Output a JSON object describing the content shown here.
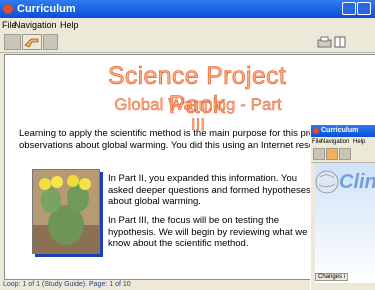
{
  "main_window": {
    "title": "Curriculum",
    "menu": [
      "File",
      "Navigation",
      "Help"
    ],
    "heading": "Science Project Pack",
    "subheading": "Global Warming - Part III",
    "intro": "Learning to apply the scientific method is the main purpose for this project. Part I, you made observations about global warming. You did this using an Internet resource called Artemis.",
    "para2": "In Part II, you expanded this information. You asked deeper questions and formed hypotheses about global warming.",
    "para3": "In Part III, the focus will be on testing the hypothesis. We will begin by reviewing what we know about the scientific method.",
    "status": "Loop: 1 of 1 (Study Guide). Page: 1 of 10"
  },
  "second_window": {
    "title": "Curriculum",
    "menu": [
      "File",
      "Navigation",
      "Help"
    ],
    "heading_fragment": "Clin",
    "button_fragment": "Changes i"
  },
  "colors": {
    "titlebar": "#0a4fd6",
    "heading": "#ffb07a",
    "status_text": "#25408f"
  },
  "icons": [
    "app-icon",
    "back-arrow-icon",
    "forward-arrow-icon",
    "print-icon",
    "bookmark-icon",
    "close-icon",
    "globe-icon"
  ]
}
